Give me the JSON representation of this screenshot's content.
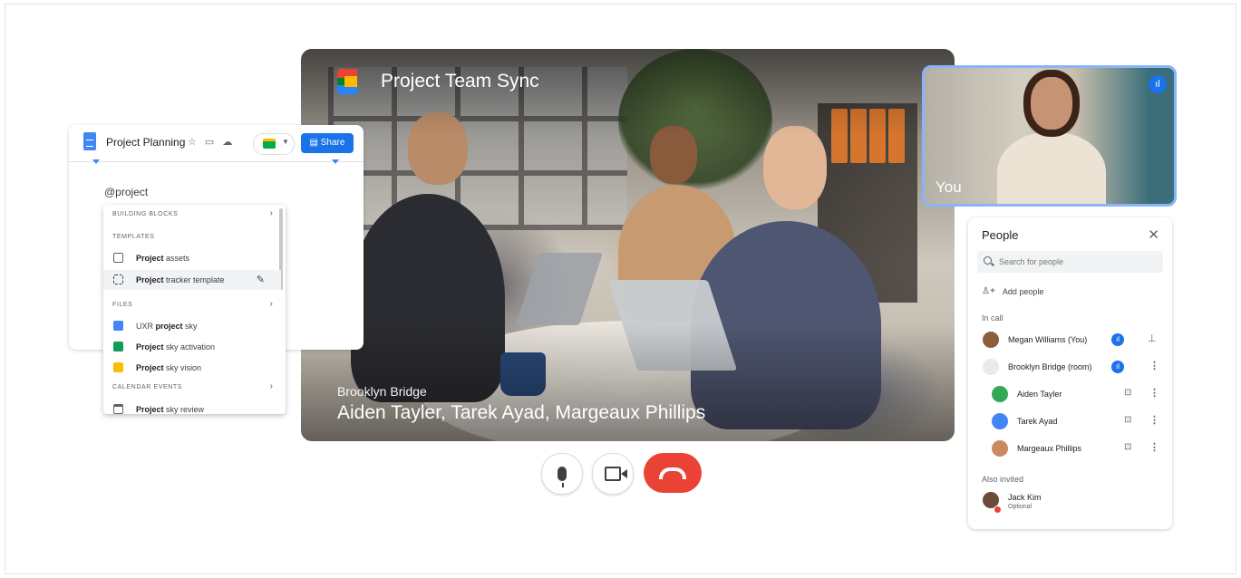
{
  "meeting": {
    "title": "Project Team Sync",
    "room_label": "Brooklyn Bridge",
    "participants_label": "Aiden Tayler, Tarek Ayad, Margeaux Phillips"
  },
  "self_view": {
    "label": "You",
    "speaking_icon": "audio-level-icon"
  },
  "controls": {
    "mic": "mic-icon",
    "camera": "videocam-icon",
    "end_call": "call-end-icon",
    "end_color": "#ea4335"
  },
  "docs": {
    "title": "Project Planning",
    "tool_icons": "☆ ▭ ☁",
    "share_label": "Share",
    "mention_text": "@project",
    "accent": "#1a73e8"
  },
  "chip_menu": {
    "sections": {
      "building_blocks": "BUILDING BLOCKS",
      "templates": "TEMPLATES",
      "files": "FILES",
      "calendar": "CALENDAR EVENTS"
    },
    "templates": [
      {
        "bold": "Project",
        "rest": " assets"
      },
      {
        "bold": "Project",
        "rest": " tracker template"
      }
    ],
    "files": [
      {
        "pre": "UXR ",
        "bold": "project",
        "rest": " sky",
        "color": "#4285f4"
      },
      {
        "pre": "",
        "bold": "Project",
        "rest": " sky activation",
        "color": "#0f9d58"
      },
      {
        "pre": "",
        "bold": "Project",
        "rest": " sky vision",
        "color": "#fbbc04"
      }
    ],
    "calendar": [
      {
        "bold": "Project",
        "rest": " sky review"
      }
    ]
  },
  "people": {
    "title": "People",
    "search_placeholder": "Search for people",
    "add_label": "Add people",
    "in_call_label": "In call",
    "in_call": [
      {
        "name": "Megan Williams (You)",
        "avatar": "#8b5e3c"
      },
      {
        "name": "Brooklyn Bridge (room)",
        "avatar": "#e8eaed"
      },
      {
        "name": "Aiden Tayler",
        "avatar": "#34a853"
      },
      {
        "name": "Tarek Ayad",
        "avatar": "#4285f4"
      },
      {
        "name": "Margeaux Phillips",
        "avatar": "#c98b5e"
      }
    ],
    "also_invited_label": "Also invited",
    "invited": [
      {
        "name": "Jack Kim",
        "sub": "Optional",
        "avatar": "#6b4a3a"
      }
    ]
  }
}
